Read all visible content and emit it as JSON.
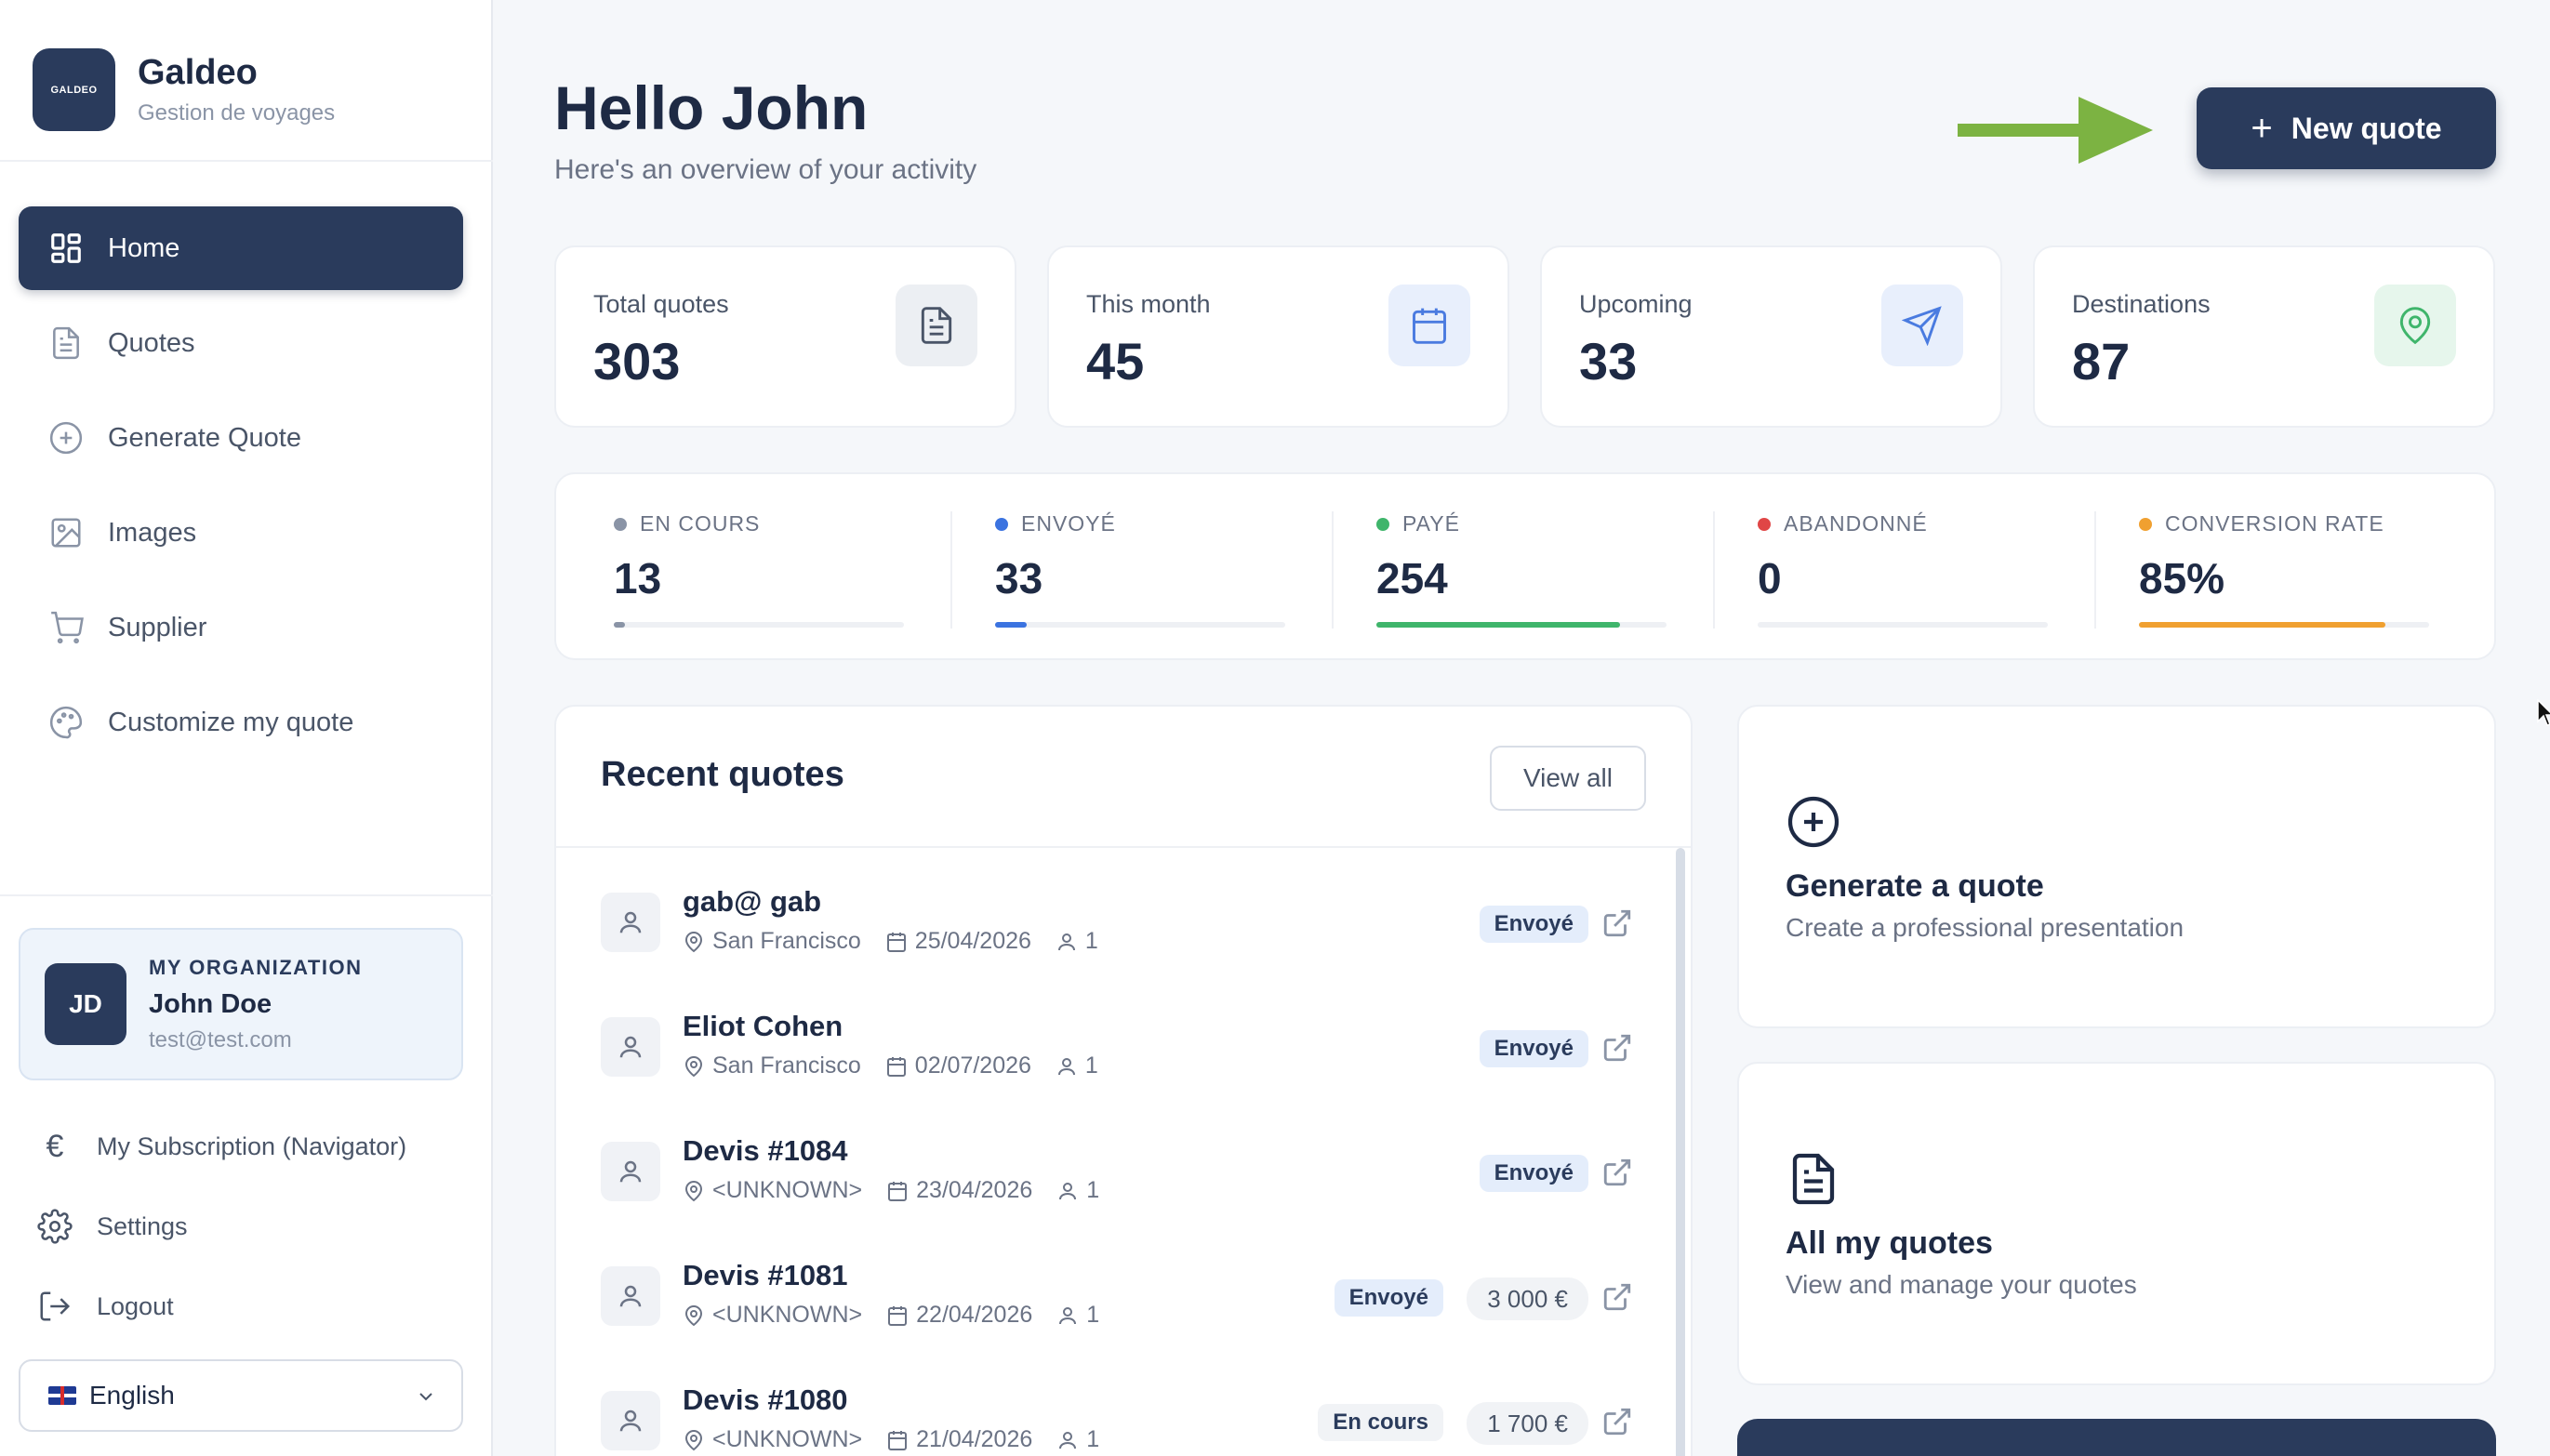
{
  "brand": {
    "logo_text": "GALDEO",
    "name": "Galdeo",
    "subtitle": "Gestion de voyages"
  },
  "nav": [
    {
      "label": "Home",
      "icon": "grid-icon",
      "active": true
    },
    {
      "label": "Quotes",
      "icon": "document-icon"
    },
    {
      "label": "Generate Quote",
      "icon": "plus-circle-icon"
    },
    {
      "label": "Images",
      "icon": "image-icon"
    },
    {
      "label": "Supplier",
      "icon": "cart-icon"
    },
    {
      "label": "Customize my quote",
      "icon": "palette-icon"
    }
  ],
  "org": {
    "initials": "JD",
    "label": "MY ORGANIZATION",
    "name": "John Doe",
    "email": "test@test.com"
  },
  "bottom_links": [
    {
      "label": "My Subscription (Navigator)",
      "icon": "euro-icon"
    },
    {
      "label": "Settings",
      "icon": "gear-icon"
    },
    {
      "label": "Logout",
      "icon": "logout-icon"
    }
  ],
  "language": {
    "selected": "English",
    "flag": "uk-flag-icon"
  },
  "header": {
    "title": "Hello John",
    "subtitle": "Here's an overview of your activity",
    "new_quote_label": "New quote",
    "arrow_color": "#7cb342"
  },
  "stats": [
    {
      "label": "Total quotes",
      "value": "303",
      "icon": "document-icon",
      "color": "#4a5568"
    },
    {
      "label": "This month",
      "value": "45",
      "icon": "calendar-icon",
      "color": "#4a7be0"
    },
    {
      "label": "Upcoming",
      "value": "33",
      "icon": "send-icon",
      "color": "#4a7be0"
    },
    {
      "label": "Destinations",
      "value": "87",
      "icon": "pin-icon",
      "color": "#3fb56b"
    }
  ],
  "statuses": [
    {
      "label": "EN COURS",
      "value": "13",
      "color": "#8a94a6",
      "fill_fraction": 0.04
    },
    {
      "label": "ENVOYÉ",
      "value": "33",
      "color": "#3b73e0",
      "fill_fraction": 0.11
    },
    {
      "label": "PAYÉ",
      "value": "254",
      "color": "#3fb56b",
      "fill_fraction": 0.84
    },
    {
      "label": "ABANDONNÉ",
      "value": "0",
      "color": "#e04646",
      "fill_fraction": 0
    },
    {
      "label": "CONVERSION RATE",
      "value": "85%",
      "color": "#f0a030",
      "fill_fraction": 0.85
    }
  ],
  "recent": {
    "title": "Recent quotes",
    "view_all": "View all",
    "rows": [
      {
        "name": "gab@ gab",
        "location": "San Francisco",
        "date": "25/04/2026",
        "people": "1",
        "status": "Envoyé",
        "status_type": "sent",
        "price": ""
      },
      {
        "name": "Eliot Cohen",
        "location": "San Francisco",
        "date": "02/07/2026",
        "people": "1",
        "status": "Envoyé",
        "status_type": "sent",
        "price": ""
      },
      {
        "name": "Devis #1084",
        "location": "<UNKNOWN>",
        "date": "23/04/2026",
        "people": "1",
        "status": "Envoyé",
        "status_type": "sent",
        "price": ""
      },
      {
        "name": "Devis #1081",
        "location": "<UNKNOWN>",
        "date": "22/04/2026",
        "people": "1",
        "status": "Envoyé",
        "status_type": "sent",
        "price": "3 000 €"
      },
      {
        "name": "Devis #1080",
        "location": "<UNKNOWN>",
        "date": "21/04/2026",
        "people": "1",
        "status": "En cours",
        "status_type": "wip",
        "price": "1 700 €"
      }
    ]
  },
  "actions": [
    {
      "title": "Generate a quote",
      "subtitle": "Create a professional presentation",
      "icon": "plus-circle-icon"
    },
    {
      "title": "All my quotes",
      "subtitle": "View and manage your quotes",
      "icon": "document-icon"
    }
  ]
}
